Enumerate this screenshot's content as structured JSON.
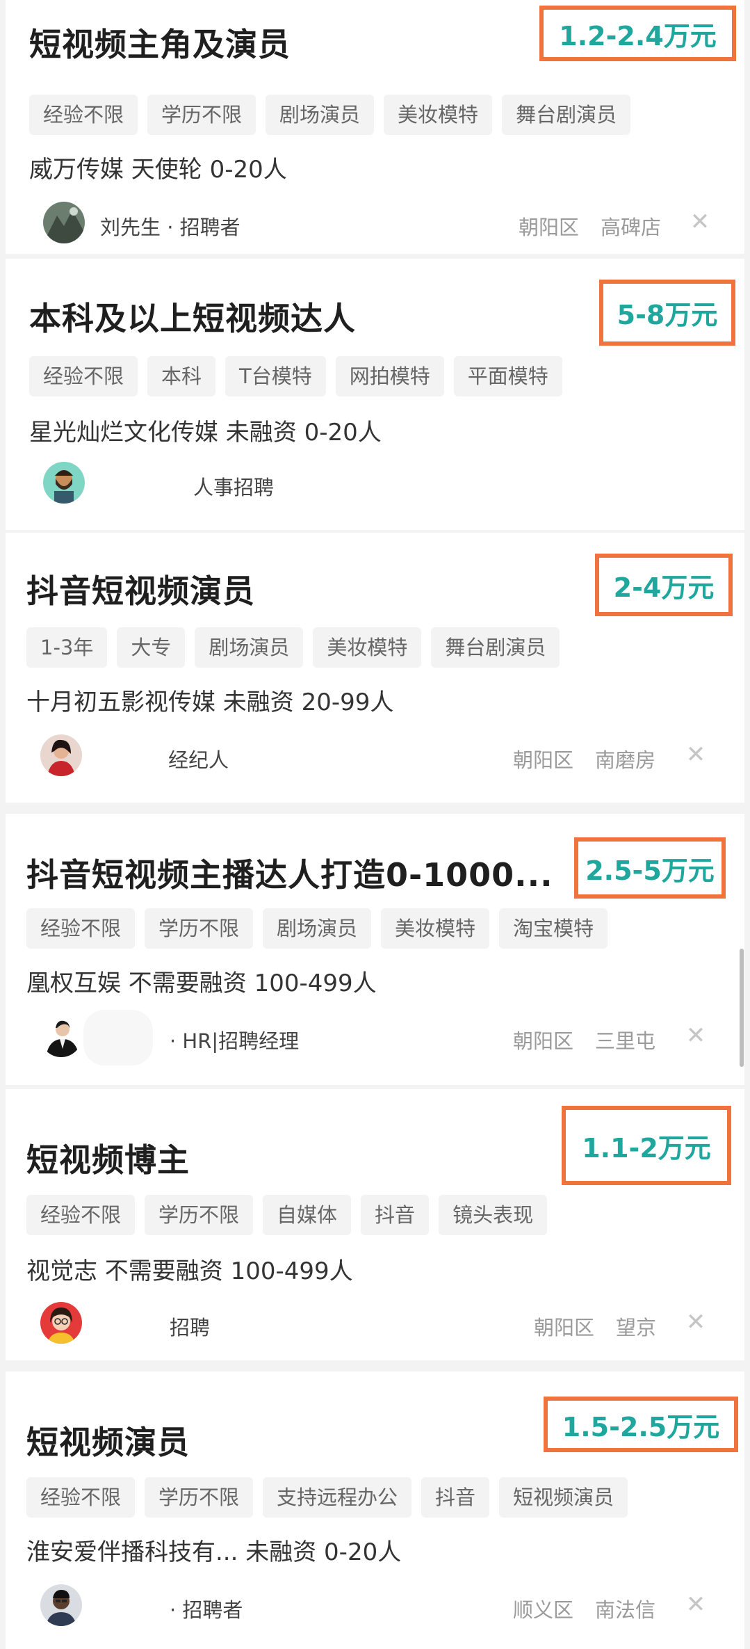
{
  "jobs": [
    {
      "title": "短视频主角及演员",
      "salary": "1.2-2.4万元",
      "tags": [
        "经验不限",
        "学历不限",
        "剧场演员",
        "美妆模特",
        "舞台剧演员"
      ],
      "company": "威万传媒  天使轮  0-20人",
      "recruiter": "刘先生 · 招聘者",
      "district": "朝阳区",
      "area": "高碑店",
      "avatar_icon": "avatar-landscape-icon"
    },
    {
      "title": "本科及以上短视频达人",
      "salary": "5-8万元",
      "tags": [
        "经验不限",
        "本科",
        "T台模特",
        "网拍模特",
        "平面模特"
      ],
      "company": "星光灿烂文化传媒  未融资  0-20人",
      "recruiter": "人事招聘",
      "district": "",
      "area": "",
      "avatar_icon": "avatar-bearded-man-icon"
    },
    {
      "title": "抖音短视频演员",
      "salary": "2-4万元",
      "tags": [
        "1-3年",
        "大专",
        "剧场演员",
        "美妆模特",
        "舞台剧演员"
      ],
      "company": "十月初五影视传媒  未融资  20-99人",
      "recruiter": "经纪人",
      "district": "朝阳区",
      "area": "南磨房",
      "avatar_icon": "avatar-person-red-icon"
    },
    {
      "title": "抖音短视频主播达人打造0-1000...",
      "salary": "2.5-5万元",
      "tags": [
        "经验不限",
        "学历不限",
        "剧场演员",
        "美妆模特",
        "淘宝模特"
      ],
      "company": "凰权互娱  不需要融资  100-499人",
      "recruiter": "· HR|招聘经理",
      "district": "朝阳区",
      "area": "三里屯",
      "avatar_icon": "avatar-suit-icon"
    },
    {
      "title": "短视频博主",
      "salary": "1.1-2万元",
      "tags": [
        "经验不限",
        "学历不限",
        "自媒体",
        "抖音",
        "镜头表现"
      ],
      "company": "视觉志  不需要融资  100-499人",
      "recruiter": "招聘",
      "district": "朝阳区",
      "area": "望京",
      "avatar_icon": "avatar-woman-glasses-icon"
    },
    {
      "title": "短视频演员",
      "salary": "1.5-2.5万元",
      "tags": [
        "经验不限",
        "学历不限",
        "支持远程办公",
        "抖音",
        "短视频演员"
      ],
      "company": "淮安爱伴播科技有...  未融资  0-20人",
      "recruiter": "· 招聘者",
      "district": "顺义区",
      "area": "南法信",
      "avatar_icon": "avatar-man-dark-icon"
    }
  ],
  "close_symbol": "✕",
  "colors": {
    "salary": "#1fa69d",
    "highlight_box": "#f0733d",
    "tag_bg": "#f3f3f3"
  }
}
